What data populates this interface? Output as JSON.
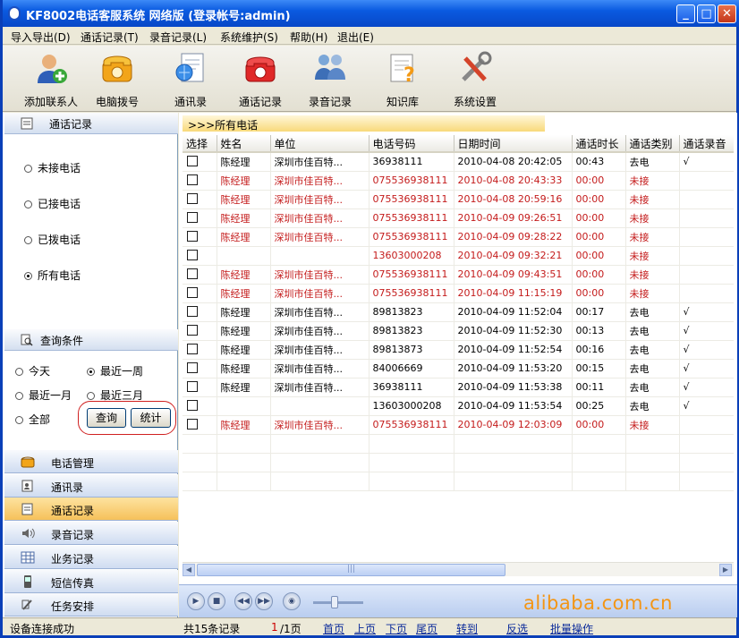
{
  "window": {
    "title": "KF8002电话客服系统 网络版 (登录帐号:admin)"
  },
  "menu": [
    "导入导出(D)",
    "通话记录(T)",
    "录音记录(L)",
    "系统维护(S)",
    "帮助(H)",
    "退出(E)"
  ],
  "toolbar": [
    {
      "label": "添加联系人",
      "icon": "add-contact-icon"
    },
    {
      "label": "电脑拨号",
      "icon": "telephone-icon"
    },
    {
      "label": "通讯录",
      "icon": "address-book-icon"
    },
    {
      "label": "通话记录",
      "icon": "call-record-icon"
    },
    {
      "label": "录音记录",
      "icon": "recording-icon"
    },
    {
      "label": "知识库",
      "icon": "knowledge-base-icon"
    },
    {
      "label": "系统设置",
      "icon": "settings-icon"
    }
  ],
  "left": {
    "section_title": "通话记录",
    "filters": [
      "未接电话",
      "已接电话",
      "已拨电话",
      "所有电话"
    ],
    "selected_filter": "所有电话",
    "query_title": "查询条件",
    "periods": [
      "今天",
      "最近一周",
      "最近一月",
      "最近三月",
      "全部"
    ],
    "selected_period": "最近一周",
    "query_button": "查询",
    "stats_button": "统计",
    "nav": [
      "电话管理",
      "通讯录",
      "通话记录",
      "录音记录",
      "业务记录",
      "短信传真",
      "任务安排"
    ],
    "selected_nav": "通话记录"
  },
  "main": {
    "breadcrumb": ">>>所有电话",
    "columns": [
      "选择",
      "姓名",
      "单位",
      "电话号码",
      "日期时间",
      "通话时长",
      "通话类别",
      "通话录音"
    ],
    "rows": [
      {
        "name": "陈经理",
        "company": "深圳市佳百特...",
        "phone": "36938111",
        "datetime": "2010-04-08 20:42:05",
        "duration": "00:43",
        "type": "去电",
        "rec": "√",
        "missed": false
      },
      {
        "name": "陈经理",
        "company": "深圳市佳百特...",
        "phone": "075536938111",
        "datetime": "2010-04-08 20:43:33",
        "duration": "00:00",
        "type": "未接",
        "rec": "",
        "missed": true
      },
      {
        "name": "陈经理",
        "company": "深圳市佳百特...",
        "phone": "075536938111",
        "datetime": "2010-04-08 20:59:16",
        "duration": "00:00",
        "type": "未接",
        "rec": "",
        "missed": true
      },
      {
        "name": "陈经理",
        "company": "深圳市佳百特...",
        "phone": "075536938111",
        "datetime": "2010-04-09 09:26:51",
        "duration": "00:00",
        "type": "未接",
        "rec": "",
        "missed": true
      },
      {
        "name": "陈经理",
        "company": "深圳市佳百特...",
        "phone": "075536938111",
        "datetime": "2010-04-09 09:28:22",
        "duration": "00:00",
        "type": "未接",
        "rec": "",
        "missed": true
      },
      {
        "name": "",
        "company": "",
        "phone": "13603000208",
        "datetime": "2010-04-09 09:32:21",
        "duration": "00:00",
        "type": "未接",
        "rec": "",
        "missed": true
      },
      {
        "name": "陈经理",
        "company": "深圳市佳百特...",
        "phone": "075536938111",
        "datetime": "2010-04-09 09:43:51",
        "duration": "00:00",
        "type": "未接",
        "rec": "",
        "missed": true
      },
      {
        "name": "陈经理",
        "company": "深圳市佳百特...",
        "phone": "075536938111",
        "datetime": "2010-04-09 11:15:19",
        "duration": "00:00",
        "type": "未接",
        "rec": "",
        "missed": true
      },
      {
        "name": "陈经理",
        "company": "深圳市佳百特...",
        "phone": "89813823",
        "datetime": "2010-04-09 11:52:04",
        "duration": "00:17",
        "type": "去电",
        "rec": "√",
        "missed": false
      },
      {
        "name": "陈经理",
        "company": "深圳市佳百特...",
        "phone": "89813823",
        "datetime": "2010-04-09 11:52:30",
        "duration": "00:13",
        "type": "去电",
        "rec": "√",
        "missed": false
      },
      {
        "name": "陈经理",
        "company": "深圳市佳百特...",
        "phone": "89813873",
        "datetime": "2010-04-09 11:52:54",
        "duration": "00:16",
        "type": "去电",
        "rec": "√",
        "missed": false
      },
      {
        "name": "陈经理",
        "company": "深圳市佳百特...",
        "phone": "84006669",
        "datetime": "2010-04-09 11:53:20",
        "duration": "00:15",
        "type": "去电",
        "rec": "√",
        "missed": false
      },
      {
        "name": "陈经理",
        "company": "深圳市佳百特...",
        "phone": "36938111",
        "datetime": "2010-04-09 11:53:38",
        "duration": "00:11",
        "type": "去电",
        "rec": "√",
        "missed": false
      },
      {
        "name": "",
        "company": "",
        "phone": "13603000208",
        "datetime": "2010-04-09 11:53:54",
        "duration": "00:25",
        "type": "去电",
        "rec": "√",
        "missed": false
      },
      {
        "name": "陈经理",
        "company": "深圳市佳百特...",
        "phone": "075536938111",
        "datetime": "2010-04-09 12:03:09",
        "duration": "00:00",
        "type": "未接",
        "rec": "",
        "missed": true
      }
    ]
  },
  "status": {
    "connection": "设备连接成功",
    "total": "共15条记录",
    "page_current": "1",
    "page_total": "/1页",
    "links": [
      "首页",
      "上页",
      "下页",
      "尾页",
      "转到",
      "反选",
      "批量操作"
    ]
  },
  "watermark": "alibaba.com.cn",
  "colors": {
    "missed": "#c41b1b",
    "title_bar": "#0a5ae0",
    "selected_nav": "#f6c15a",
    "watermark": "#f39514"
  }
}
